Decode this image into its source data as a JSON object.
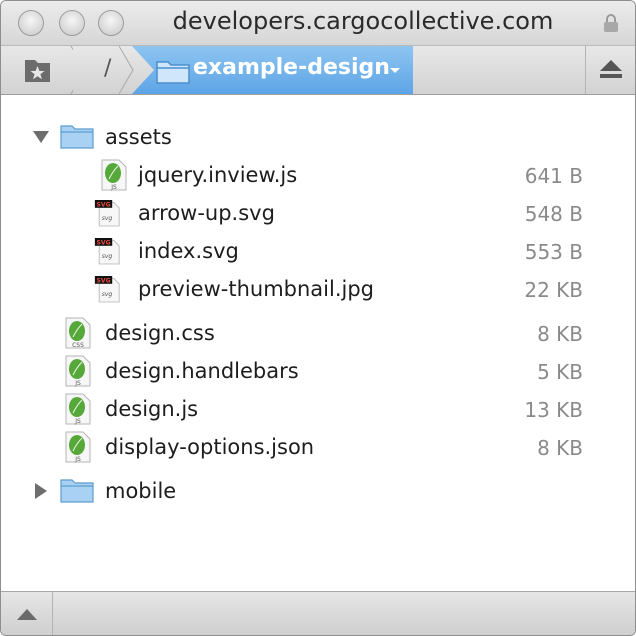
{
  "window": {
    "title": "developers.cargocollective.com"
  },
  "toolbar": {
    "root_label": "/",
    "current_folder": "example-design"
  },
  "files": [
    {
      "name": "assets",
      "type": "folder",
      "expanded": true,
      "size": ""
    },
    {
      "name": "jquery.inview.js",
      "type": "js",
      "size": "641 B"
    },
    {
      "name": "arrow-up.svg",
      "type": "svg",
      "size": "548 B"
    },
    {
      "name": "index.svg",
      "type": "svg",
      "size": "553 B"
    },
    {
      "name": "preview-thumbnail.jpg",
      "type": "svg",
      "size": "22 KB"
    },
    {
      "name": "design.css",
      "type": "css",
      "size": "8 KB"
    },
    {
      "name": "design.handlebars",
      "type": "js",
      "size": "5 KB"
    },
    {
      "name": "design.js",
      "type": "js",
      "size": "13 KB"
    },
    {
      "name": "display-options.json",
      "type": "js",
      "size": "8 KB"
    },
    {
      "name": "mobile",
      "type": "folder",
      "expanded": false,
      "size": ""
    }
  ],
  "icons": {
    "js_label": "JS",
    "css_label": "CSS",
    "svg_label": "SVG",
    "leaf_color": "#56a83a",
    "folder_color": "#8cc2ea"
  },
  "colors": {
    "accent": "#6aaee9"
  }
}
